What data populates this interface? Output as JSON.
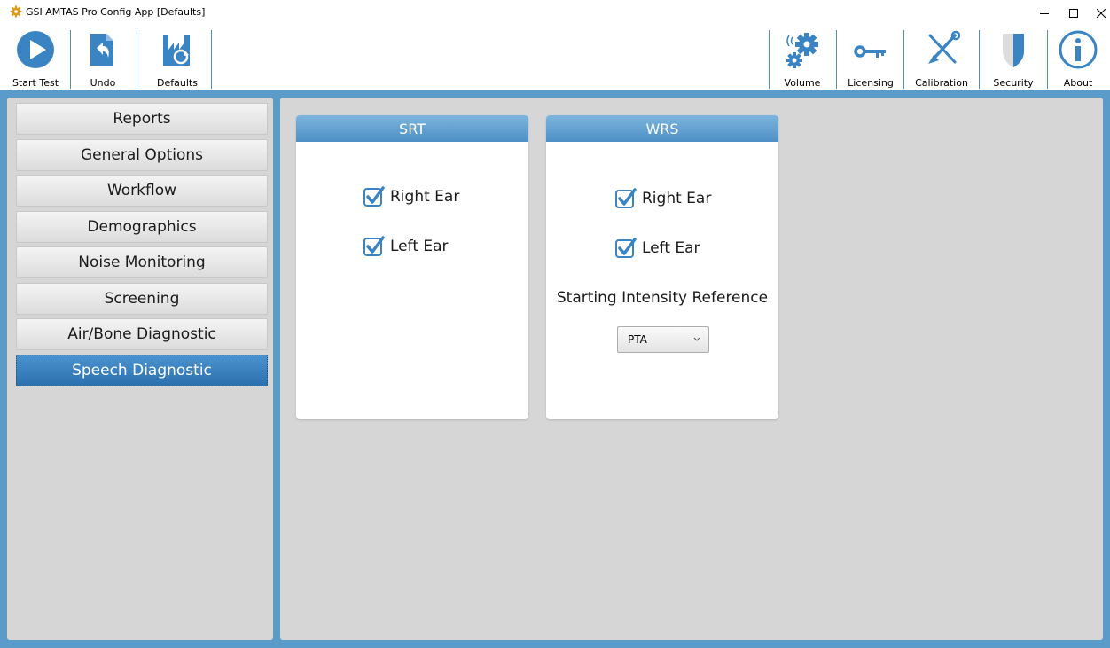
{
  "window": {
    "title": "GSI AMTAS Pro Config App [Defaults]",
    "controls": [
      "minimize",
      "maximize",
      "close"
    ]
  },
  "toolbar": {
    "left": [
      {
        "label": "Start Test",
        "icon": "play-icon"
      },
      {
        "label": "Undo",
        "icon": "undo-icon"
      },
      {
        "label": "Defaults",
        "icon": "defaults-icon"
      }
    ],
    "right": [
      {
        "label": "Volume",
        "icon": "volume-gear-icon"
      },
      {
        "label": "Licensing",
        "icon": "key-icon"
      },
      {
        "label": "Calibration",
        "icon": "tools-icon"
      },
      {
        "label": "Security",
        "icon": "shield-icon"
      },
      {
        "label": "About",
        "icon": "info-icon"
      }
    ]
  },
  "sidebar": {
    "items": [
      {
        "label": "Reports",
        "active": false
      },
      {
        "label": "General Options",
        "active": false
      },
      {
        "label": "Workflow",
        "active": false
      },
      {
        "label": "Demographics",
        "active": false
      },
      {
        "label": "Noise Monitoring",
        "active": false
      },
      {
        "label": "Screening",
        "active": false
      },
      {
        "label": "Air/Bone Diagnostic",
        "active": false
      },
      {
        "label": "Speech Diagnostic",
        "active": true
      }
    ]
  },
  "main": {
    "srt": {
      "header": "SRT",
      "right_ear": {
        "label": "Right Ear",
        "checked": true
      },
      "left_ear": {
        "label": "Left Ear",
        "checked": true
      }
    },
    "wrs": {
      "header": "WRS",
      "right_ear": {
        "label": "Right Ear",
        "checked": true
      },
      "left_ear": {
        "label": "Left Ear",
        "checked": true
      },
      "intensity_label": "Starting Intensity Reference",
      "intensity_value": "PTA"
    }
  },
  "colors": {
    "accent": "#4d90c6",
    "frame": "#5b9bc9",
    "panel": "#d6d6d6",
    "active_nav": "#2c70ae",
    "separator": "#4a90c8"
  }
}
